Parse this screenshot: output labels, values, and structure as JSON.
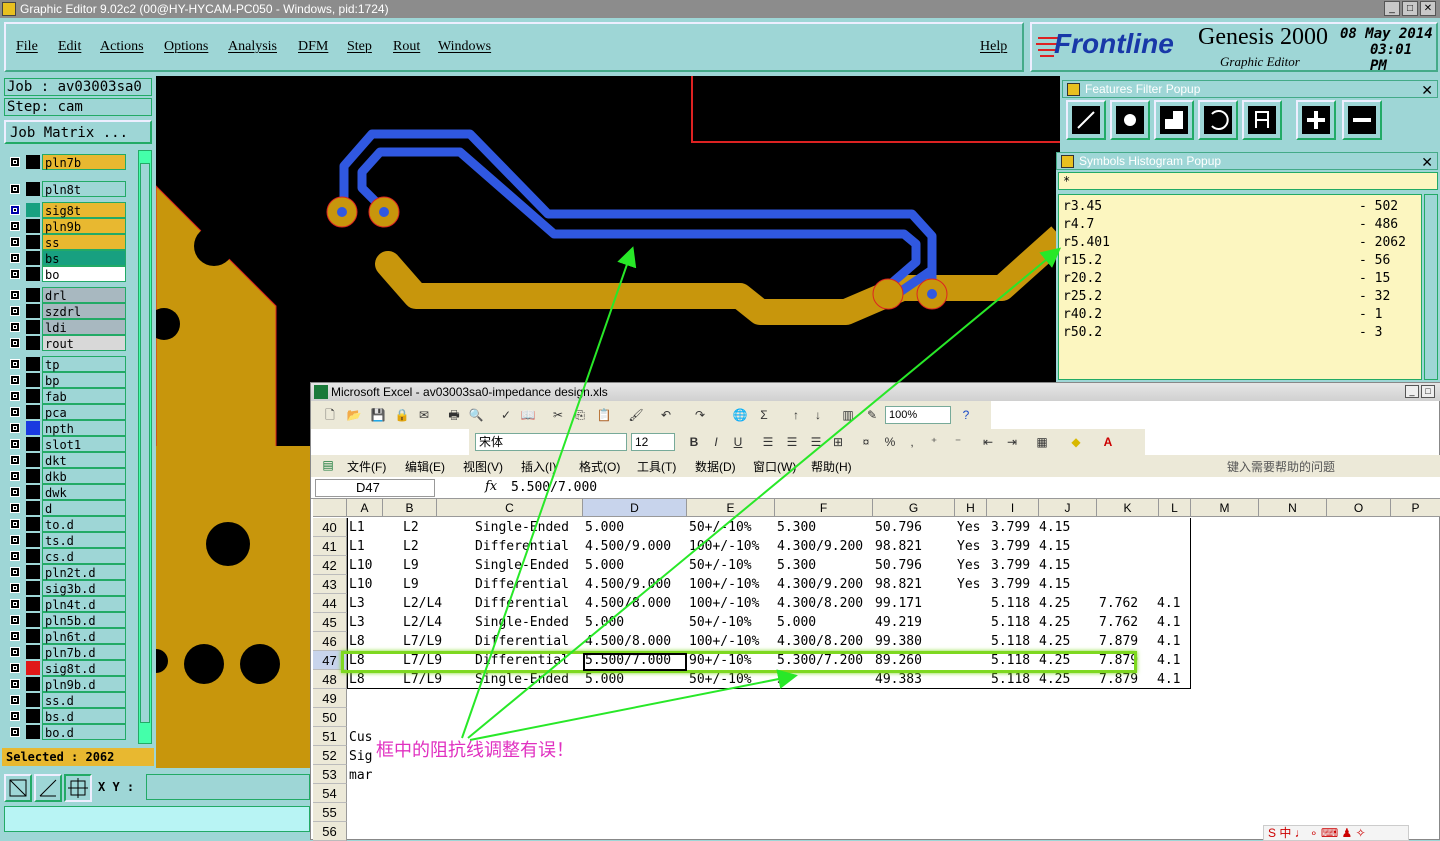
{
  "window": {
    "title": "Graphic Editor 9.02c2 (00@HY-HYCAM-PC050 - Windows, pid:1724)"
  },
  "menu": {
    "items": [
      "File",
      "Edit",
      "Actions",
      "Options",
      "Analysis",
      "DFM",
      "Step",
      "Rout",
      "Windows"
    ],
    "help": "Help"
  },
  "brand": {
    "logo": "Frontline",
    "product": "Genesis 2000",
    "subtitle": "Graphic Editor",
    "date": "08 May 2014",
    "time": "03:01 PM"
  },
  "job": {
    "name": "Job : av03003sa0",
    "step": "Step: cam",
    "matrix_button": "Job Matrix ..."
  },
  "layers": [
    {
      "name": "pln7b",
      "bg": "#e8b830"
    },
    {
      "name": "pln8t",
      "bg": "#9ed6d6"
    },
    {
      "name": "sig8t",
      "bg": "#e8b830"
    },
    {
      "name": "pln9b",
      "bg": "#e8b830"
    },
    {
      "name": "ss",
      "bg": "#e8b830"
    },
    {
      "name": "bs",
      "bg": "#18a080"
    },
    {
      "name": "bo",
      "bg": "#ffffff"
    },
    {
      "name": "drl",
      "bg": "#a8b8c0"
    },
    {
      "name": "szdrl",
      "bg": "#a8b8c0"
    },
    {
      "name": "ldi",
      "bg": "#a8b8c0"
    },
    {
      "name": "rout",
      "bg": "#d8d8d8"
    },
    {
      "name": "tp",
      "bg": "#9ed6d6"
    },
    {
      "name": "bp",
      "bg": "#9ed6d6"
    },
    {
      "name": "fab",
      "bg": "#9ed6d6"
    },
    {
      "name": "pca",
      "bg": "#9ed6d6"
    },
    {
      "name": "npth",
      "bg": "#9ed6d6"
    },
    {
      "name": "slot1",
      "bg": "#9ed6d6"
    },
    {
      "name": "dkt",
      "bg": "#9ed6d6"
    },
    {
      "name": "dkb",
      "bg": "#9ed6d6"
    },
    {
      "name": "dwk",
      "bg": "#9ed6d6"
    },
    {
      "name": "d",
      "bg": "#9ed6d6"
    },
    {
      "name": "to.d",
      "bg": "#9ed6d6"
    },
    {
      "name": "ts.d",
      "bg": "#9ed6d6"
    },
    {
      "name": "cs.d",
      "bg": "#9ed6d6"
    },
    {
      "name": "pln2t.d",
      "bg": "#9ed6d6"
    },
    {
      "name": "sig3b.d",
      "bg": "#9ed6d6"
    },
    {
      "name": "pln4t.d",
      "bg": "#9ed6d6"
    },
    {
      "name": "pln5b.d",
      "bg": "#9ed6d6"
    },
    {
      "name": "pln6t.d",
      "bg": "#9ed6d6"
    },
    {
      "name": "pln7b.d",
      "bg": "#9ed6d6"
    },
    {
      "name": "sig8t.d",
      "bg": "#9ed6d6"
    },
    {
      "name": "pln9b.d",
      "bg": "#9ed6d6"
    },
    {
      "name": "ss.d",
      "bg": "#9ed6d6"
    },
    {
      "name": "bs.d",
      "bg": "#9ed6d6"
    },
    {
      "name": "bo.d",
      "bg": "#9ed6d6"
    }
  ],
  "status": {
    "selected": "Selected : 2062",
    "xy_label": "X Y :"
  },
  "features_filter": {
    "title": "Features Filter Popup",
    "tools": [
      "line-tool-icon",
      "pad-tool-icon",
      "surface-tool-icon",
      "arc-tool-icon",
      "text-tool-icon",
      "add-filter-icon",
      "remove-filter-icon"
    ]
  },
  "histogram": {
    "title": "Symbols Histogram Popup",
    "filter": "*",
    "rows": [
      {
        "symbol": "r3.45",
        "count": "- 502"
      },
      {
        "symbol": "r4.7",
        "count": "- 486"
      },
      {
        "symbol": "r5.401",
        "count": "- 2062"
      },
      {
        "symbol": "r15.2",
        "count": "- 56"
      },
      {
        "symbol": "r20.2",
        "count": "- 15"
      },
      {
        "symbol": "r25.2",
        "count": "- 32"
      },
      {
        "symbol": "r40.2",
        "count": "- 1"
      },
      {
        "symbol": "r50.2",
        "count": "- 3"
      }
    ]
  },
  "excel": {
    "title": "Microsoft Excel - av03003sa0-impedance design.xls",
    "zoom": "100%",
    "font": "宋体",
    "font_size": "12",
    "menu": [
      "文件(F)",
      "编辑(E)",
      "视图(V)",
      "插入(I)",
      "格式(O)",
      "工具(T)",
      "数据(D)",
      "窗口(W)",
      "帮助(H)"
    ],
    "help_placeholder": "键入需要帮助的问题",
    "name_box": "D47",
    "fx": "fx",
    "formula": "5.500/7.000",
    "columns": [
      "A",
      "B",
      "C",
      "D",
      "E",
      "F",
      "G",
      "H",
      "I",
      "J",
      "K",
      "L",
      "M",
      "N",
      "O",
      "P"
    ],
    "row_numbers": [
      "40",
      "41",
      "42",
      "43",
      "44",
      "45",
      "46",
      "47",
      "48",
      "49",
      "50",
      "51",
      "52",
      "53",
      "54",
      "55",
      "56"
    ],
    "rows": [
      [
        "L1",
        "L2",
        "Single-Ended",
        "5.000",
        "50+/-10%",
        "5.300",
        "50.796",
        "Yes",
        "3.799",
        "4.15",
        "",
        ""
      ],
      [
        "L1",
        "L2",
        "Differential",
        "4.500/9.000",
        "100+/-10%",
        "4.300/9.200",
        "98.821",
        "Yes",
        "3.799",
        "4.15",
        "",
        ""
      ],
      [
        "L10",
        "L9",
        "Single-Ended",
        "5.000",
        "50+/-10%",
        "5.300",
        "50.796",
        "Yes",
        "3.799",
        "4.15",
        "",
        ""
      ],
      [
        "L10",
        "L9",
        "Differential",
        "4.500/9.000",
        "100+/-10%",
        "4.300/9.200",
        "98.821",
        "Yes",
        "3.799",
        "4.15",
        "",
        ""
      ],
      [
        "L3",
        "L2/L4",
        "Differential",
        "4.500/8.000",
        "100+/-10%",
        "4.300/8.200",
        "99.171",
        "",
        "5.118",
        "4.25",
        "7.762",
        "4.1"
      ],
      [
        "L3",
        "L2/L4",
        "Single-Ended",
        "5.000",
        "50+/-10%",
        "5.000",
        "49.219",
        "",
        "5.118",
        "4.25",
        "7.762",
        "4.1"
      ],
      [
        "L8",
        "L7/L9",
        "Differential",
        "4.500/8.000",
        "100+/-10%",
        "4.300/8.200",
        "99.380",
        "",
        "5.118",
        "4.25",
        "7.879",
        "4.1"
      ],
      [
        "L8",
        "L7/L9",
        "Differential",
        "5.500/7.000",
        "90+/-10%",
        "5.300/7.200",
        "89.260",
        "",
        "5.118",
        "4.25",
        "7.879",
        "4.1"
      ],
      [
        "L8",
        "L7/L9",
        "Single-Ended",
        "5.000",
        "50+/-10%",
        "5",
        "49.383",
        "",
        "5.118",
        "4.25",
        "7.879",
        "4.1"
      ]
    ],
    "notes": [
      "Cus",
      "Sig",
      "mar"
    ]
  },
  "annotation": {
    "text": "框中的阻抗线调整有误！"
  }
}
